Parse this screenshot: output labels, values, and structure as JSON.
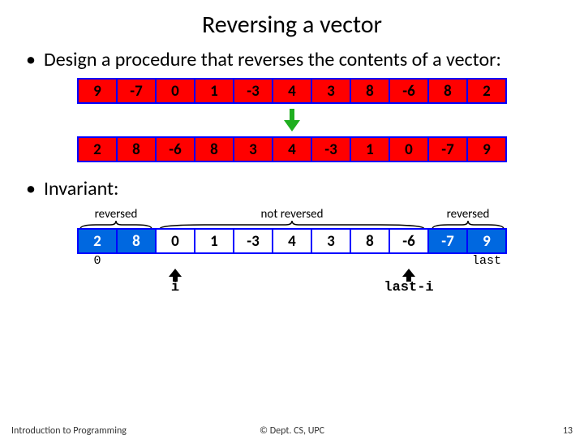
{
  "title": "Reversing a vector",
  "bullet1": "Design a procedure that reverses the contents of a vector:",
  "bullet2": "Invariant:",
  "vec_top": [
    "9",
    "-7",
    "0",
    "1",
    "-3",
    "4",
    "3",
    "8",
    "-6",
    "8",
    "2"
  ],
  "vec_bottom": [
    "2",
    "8",
    "-6",
    "8",
    "3",
    "4",
    "-3",
    "1",
    "0",
    "-7",
    "9"
  ],
  "inv_labels": {
    "left": "reversed",
    "mid": "not reversed",
    "right": "reversed"
  },
  "vec_inv": [
    "2",
    "8",
    "0",
    "1",
    "-3",
    "4",
    "3",
    "8",
    "-6",
    "-7",
    "9"
  ],
  "inv_colors": [
    "b",
    "b",
    "w",
    "w",
    "w",
    "w",
    "w",
    "w",
    "w",
    "b",
    "b"
  ],
  "idx": {
    "zero": "0",
    "last": "last"
  },
  "ptr": {
    "i": "i",
    "lasti": "last-i"
  },
  "footer": {
    "left": "Introduction to Programming",
    "center": "© Dept. CS, UPC",
    "right": "13"
  }
}
